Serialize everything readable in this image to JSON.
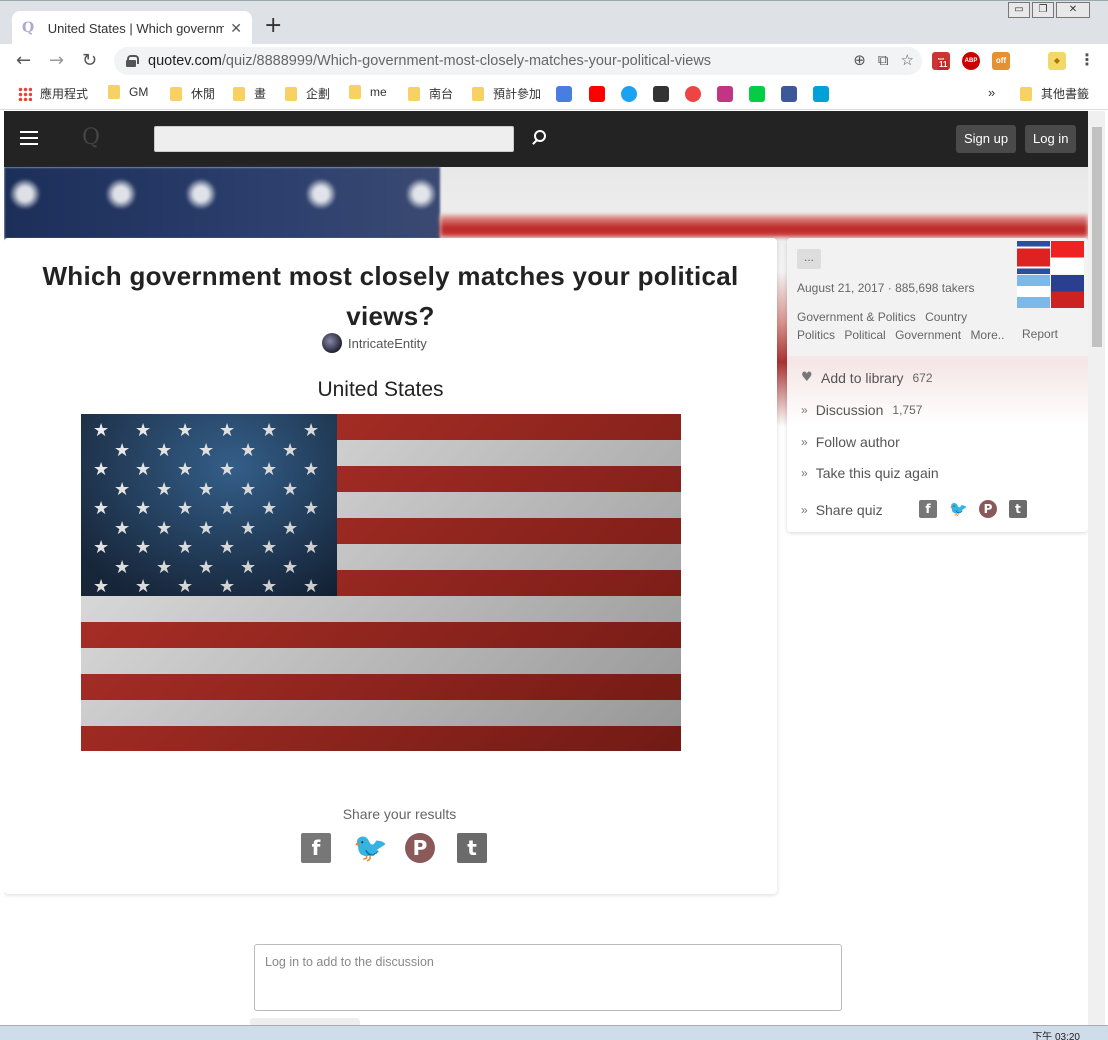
{
  "browser": {
    "tab_title": "United States | Which governm",
    "tab_favicon": "Q",
    "tab_close": "✕",
    "new_tab": "+",
    "url_host": "quotev.com",
    "url_path": "/quiz/8888999/Which-government-most-closely-matches-your-political-views",
    "window_controls": [
      "▭",
      "❐",
      "✕"
    ],
    "bookmarks": [
      "應用程式",
      "GM",
      "休閒",
      "畫",
      "企劃",
      "me",
      "南台",
      "預計參加"
    ],
    "bookmarks_overflow": "»",
    "other_bookmarks": "其他書籤",
    "ext_badges": [
      "11",
      "ABP",
      "off"
    ]
  },
  "site": {
    "logo": "Q",
    "signup": "Sign up",
    "login": "Log in"
  },
  "quiz": {
    "title": "Which government most closely matches your political views?",
    "author": "IntricateEntity",
    "result": "United States",
    "share_label": "Share your results"
  },
  "sidebar": {
    "more": "...",
    "meta": "August 21, 2017 · 885,698 takers",
    "tags": [
      "Government & Politics",
      "Country",
      "Politics",
      "Political",
      "Government",
      "More.."
    ],
    "report": "Report",
    "add_library": "Add to library",
    "library_count": "672",
    "discussion": "Discussion",
    "discussion_count": "1,757",
    "follow": "Follow author",
    "retake": "Take this quiz again",
    "share": "Share quiz"
  },
  "comment": {
    "placeholder": "Log in to add to the discussion"
  },
  "taskbar": {
    "clock": "下午 03:20"
  },
  "colors": {
    "navbar": "#232323",
    "facebook": "#777777",
    "twitter": "#9aa0a8",
    "pinterest": "#8a5a5a",
    "tumblr": "#6b6b6b"
  }
}
